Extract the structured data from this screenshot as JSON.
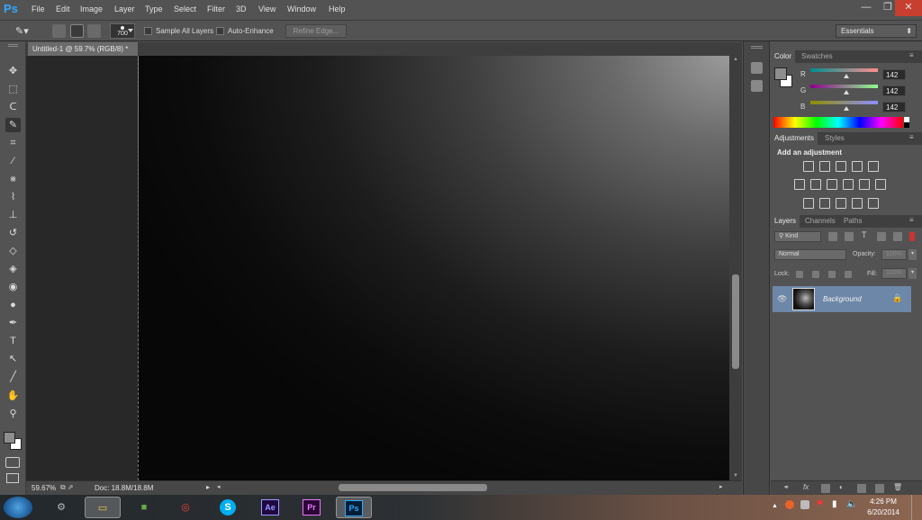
{
  "menubar": {
    "logo": "Ps",
    "items": [
      "File",
      "Edit",
      "Image",
      "Layer",
      "Type",
      "Select",
      "Filter",
      "3D",
      "View",
      "Window",
      "Help"
    ]
  },
  "window_controls": {
    "minimize": "—",
    "restore": "❐",
    "close": "✕"
  },
  "options": {
    "brush_size": "700",
    "sample_all_layers": "Sample All Layers",
    "auto_enhance": "Auto-Enhance",
    "refine_edge": "Refine Edge...",
    "workspace": "Essentials"
  },
  "tools": [
    {
      "name": "move-tool",
      "glyph": "✥"
    },
    {
      "name": "marquee-tool",
      "glyph": "⬚"
    },
    {
      "name": "lasso-tool",
      "glyph": "ᑕ"
    },
    {
      "name": "quick-selection-tool",
      "glyph": "✎"
    },
    {
      "name": "crop-tool",
      "glyph": "⌗"
    },
    {
      "name": "eyedropper-tool",
      "glyph": "⁄"
    },
    {
      "name": "healing-brush-tool",
      "glyph": "⨳"
    },
    {
      "name": "brush-tool",
      "glyph": "⌇"
    },
    {
      "name": "clone-stamp-tool",
      "glyph": "⊥"
    },
    {
      "name": "history-brush-tool",
      "glyph": "↺"
    },
    {
      "name": "eraser-tool",
      "glyph": "◇"
    },
    {
      "name": "paint-bucket-tool",
      "glyph": "◈"
    },
    {
      "name": "blur-tool",
      "glyph": "◉"
    },
    {
      "name": "dodge-tool",
      "glyph": "●"
    },
    {
      "name": "pen-tool",
      "glyph": "✒"
    },
    {
      "name": "type-tool",
      "glyph": "T"
    },
    {
      "name": "path-selection-tool",
      "glyph": "↖"
    },
    {
      "name": "line-tool",
      "glyph": "╱"
    },
    {
      "name": "hand-tool",
      "glyph": "✋"
    },
    {
      "name": "zoom-tool",
      "glyph": "⚲"
    }
  ],
  "document": {
    "tab_title": "Untitled-1 @ 59.7% (RGB/8) *",
    "zoom": "59.67%",
    "doc_size": "Doc: 18.8M/18.8M"
  },
  "color_panel": {
    "tabs": [
      "Color",
      "Swatches"
    ],
    "channels": [
      {
        "label": "R",
        "value": "142"
      },
      {
        "label": "G",
        "value": "142"
      },
      {
        "label": "B",
        "value": "142"
      }
    ],
    "foreground": "#8e8e8e",
    "background": "#ffffff"
  },
  "adjustments_panel": {
    "tabs": [
      "Adjustments",
      "Styles"
    ],
    "heading": "Add an adjustment"
  },
  "layers_panel": {
    "tabs": [
      "Layers",
      "Channels",
      "Paths"
    ],
    "filter_kind": "Kind",
    "blend_mode": "Normal",
    "opacity_label": "Opacity:",
    "opacity_value": "100%",
    "lock_label": "Lock:",
    "fill_label": "Fill:",
    "fill_value": "100%",
    "layers": [
      {
        "name": "Background"
      }
    ]
  },
  "taskbar": {
    "apps": [
      {
        "name": "start-button",
        "label": ""
      },
      {
        "name": "steam-app",
        "label": ""
      },
      {
        "name": "file-explorer-app",
        "label": ""
      },
      {
        "name": "minecraft-app",
        "label": ""
      },
      {
        "name": "chrome-app",
        "label": ""
      },
      {
        "name": "skype-app",
        "label": "S"
      },
      {
        "name": "after-effects-app",
        "label": "Ae"
      },
      {
        "name": "premiere-app",
        "label": "Pr"
      },
      {
        "name": "photoshop-app",
        "label": "Ps"
      }
    ],
    "time": "4:26 PM",
    "date": "6/20/2014"
  }
}
